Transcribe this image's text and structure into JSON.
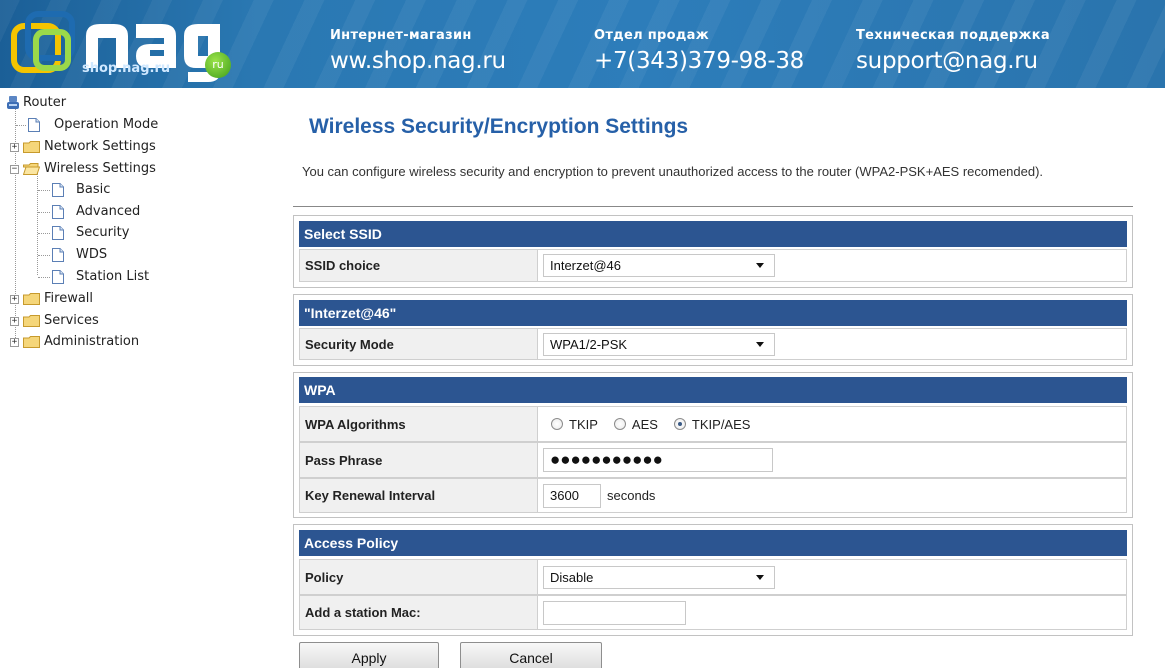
{
  "banner": {
    "logo_domain": "shop.nag.ru",
    "logo_badge": "ru",
    "logo_wordmark": "nag",
    "contacts": [
      {
        "caption": "Интернет-магазин",
        "value": "ww.shop.nag.ru"
      },
      {
        "caption": "Отдел продаж",
        "value": "+7(343)379-98-38"
      },
      {
        "caption": "Техническая поддержка",
        "value": "support@nag.ru"
      }
    ]
  },
  "tree": {
    "root": "Router",
    "items": [
      {
        "label": "Operation Mode",
        "icon": "page-icon"
      },
      {
        "label": "Network Settings",
        "icon": "folder-icon",
        "state": "collapsed"
      },
      {
        "label": "Wireless Settings",
        "icon": "folder-open-icon",
        "state": "expanded",
        "children": [
          "Basic",
          "Advanced",
          "Security",
          "WDS",
          "Station List"
        ]
      },
      {
        "label": "Firewall",
        "icon": "folder-icon",
        "state": "collapsed"
      },
      {
        "label": "Services",
        "icon": "folder-icon",
        "state": "collapsed"
      },
      {
        "label": "Administration",
        "icon": "folder-icon",
        "state": "collapsed"
      }
    ]
  },
  "page": {
    "title": "Wireless Security/Encryption Settings",
    "description": "You can configure wireless security and encryption to prevent unauthorized access to the router (WPA2-PSK+AES recomended)."
  },
  "sections": {
    "ssid": {
      "header": "Select SSID",
      "choice_label": "SSID choice",
      "choice_value": "Interzet@46"
    },
    "security": {
      "header": "\"Interzet@46\"",
      "mode_label": "Security Mode",
      "mode_value": "WPA1/2-PSK"
    },
    "wpa": {
      "header": "WPA",
      "algorithms_label": "WPA Algorithms",
      "algorithms": [
        {
          "label": "TKIP",
          "checked": false
        },
        {
          "label": "AES",
          "checked": false
        },
        {
          "label": "TKIP/AES",
          "checked": true
        }
      ],
      "passphrase_label": "Pass Phrase",
      "passphrase_value": "●●●●●●●●●●●",
      "renewal_label": "Key Renewal Interval",
      "renewal_value": "3600",
      "renewal_unit": "seconds"
    },
    "policy": {
      "header": "Access Policy",
      "policy_label": "Policy",
      "policy_value": "Disable",
      "mac_label": "Add a station Mac:",
      "mac_value": ""
    }
  },
  "buttons": {
    "apply": "Apply",
    "cancel": "Cancel"
  },
  "colors": {
    "banner": "#2d7dba",
    "section_header": "#2c5591",
    "title": "#2660a8"
  }
}
